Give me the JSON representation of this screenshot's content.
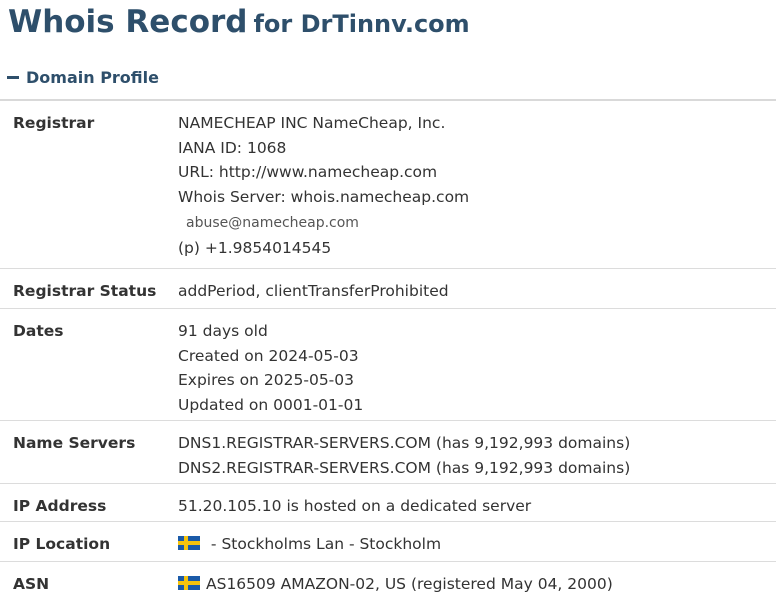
{
  "title": {
    "main": "Whois Record",
    "sub": "for DrTinnv.com"
  },
  "section": {
    "label": "Domain Profile"
  },
  "rows": {
    "registrar": {
      "label": "Registrar",
      "lines": [
        "NAMECHEAP INC NameCheap, Inc.",
        "IANA ID: 1068",
        "URL: http://www.namecheap.com",
        "Whois Server: whois.namecheap.com"
      ],
      "email": "abuse@namecheap.com",
      "phone": "(p)  +1.9854014545"
    },
    "status": {
      "label": "Registrar Status",
      "value": "addPeriod, clientTransferProhibited"
    },
    "dates": {
      "label": "Dates",
      "lines": [
        "91 days old",
        "Created on 2024-05-03",
        "Expires on 2025-05-03",
        "Updated on 0001-01-01"
      ]
    },
    "nameservers": {
      "label": "Name Servers",
      "lines": [
        "DNS1.REGISTRAR-SERVERS.COM (has 9,192,993 domains)",
        "DNS2.REGISTRAR-SERVERS.COM (has 9,192,993 domains)"
      ]
    },
    "ip": {
      "label": "IP Address",
      "value": "51.20.105.10 is hosted on a dedicated server"
    },
    "location": {
      "label": "IP Location",
      "value": " - Stockholms Lan - Stockholm",
      "flag": "sweden-flag-icon"
    },
    "asn": {
      "label": "ASN",
      "value": "AS16509 AMAZON-02, US (registered May 04, 2000)",
      "flag": "sweden-flag-icon"
    }
  }
}
